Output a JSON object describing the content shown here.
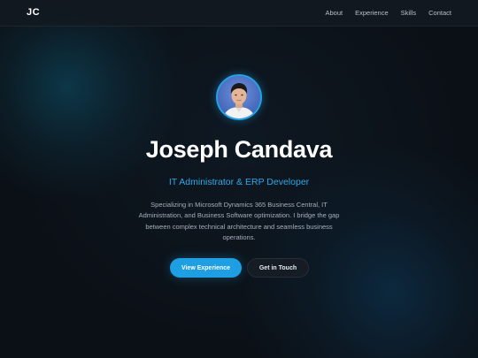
{
  "nav": {
    "logo": "JC",
    "links": [
      {
        "label": "About"
      },
      {
        "label": "Experience"
      },
      {
        "label": "Skills"
      },
      {
        "label": "Contact"
      }
    ]
  },
  "hero": {
    "name": "Joseph Candava",
    "role": "IT Administrator & ERP Developer",
    "description": "Specializing in Microsoft Dynamics 365 Business Central, IT Administration, and Business Software optimization. I bridge the gap between complex technical architecture and seamless business operations.",
    "primary_button": "View Experience",
    "secondary_button": "Get in Touch"
  },
  "colors": {
    "accent": "#1e9fe4",
    "background": "#0b1016",
    "text": "#ffffff",
    "muted_text": "#a6b0bc"
  }
}
